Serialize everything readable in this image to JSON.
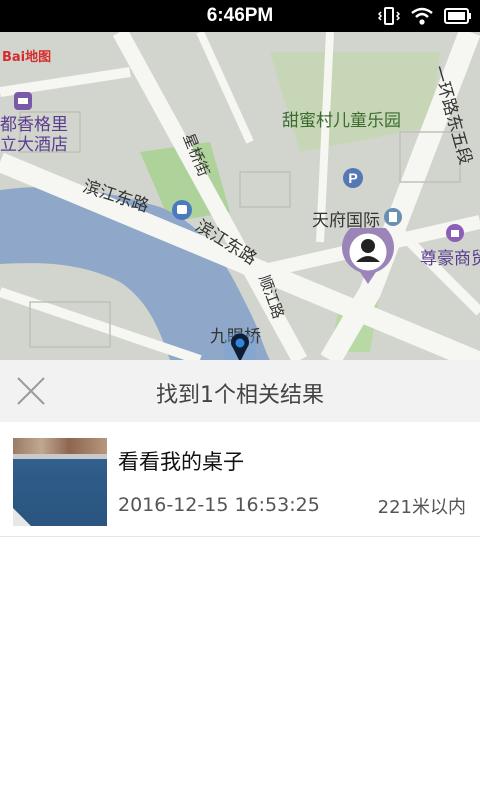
{
  "status_bar": {
    "time": "6:46PM"
  },
  "map": {
    "brand": "Bai地图",
    "labels": {
      "hotel1": "都香格里",
      "hotel2": "立大酒店",
      "park": "甜蜜村儿童乐园",
      "road_binjiang_east_1": "滨江东路",
      "road_binjiang_east_2": "滨江东路",
      "street_xingqiao": "星桥街",
      "tianfu": "天府国际",
      "huanlu": "一环路东五段",
      "zunhao": "尊豪商贸",
      "shunjiang": "顺江路",
      "jiuyanqiao": "九眼桥"
    },
    "colors": {
      "water": "#8fa7c8",
      "road": "#f6f6f2",
      "green": "#aed39a",
      "marker_user": "#9b84b8",
      "marker_location": "#1d4f9a"
    }
  },
  "results": {
    "title": "找到1个相关结果",
    "items": [
      {
        "title": "看看我的桌子",
        "time": "2016-12-15 16:53:25",
        "distance": "221米以内"
      }
    ]
  }
}
